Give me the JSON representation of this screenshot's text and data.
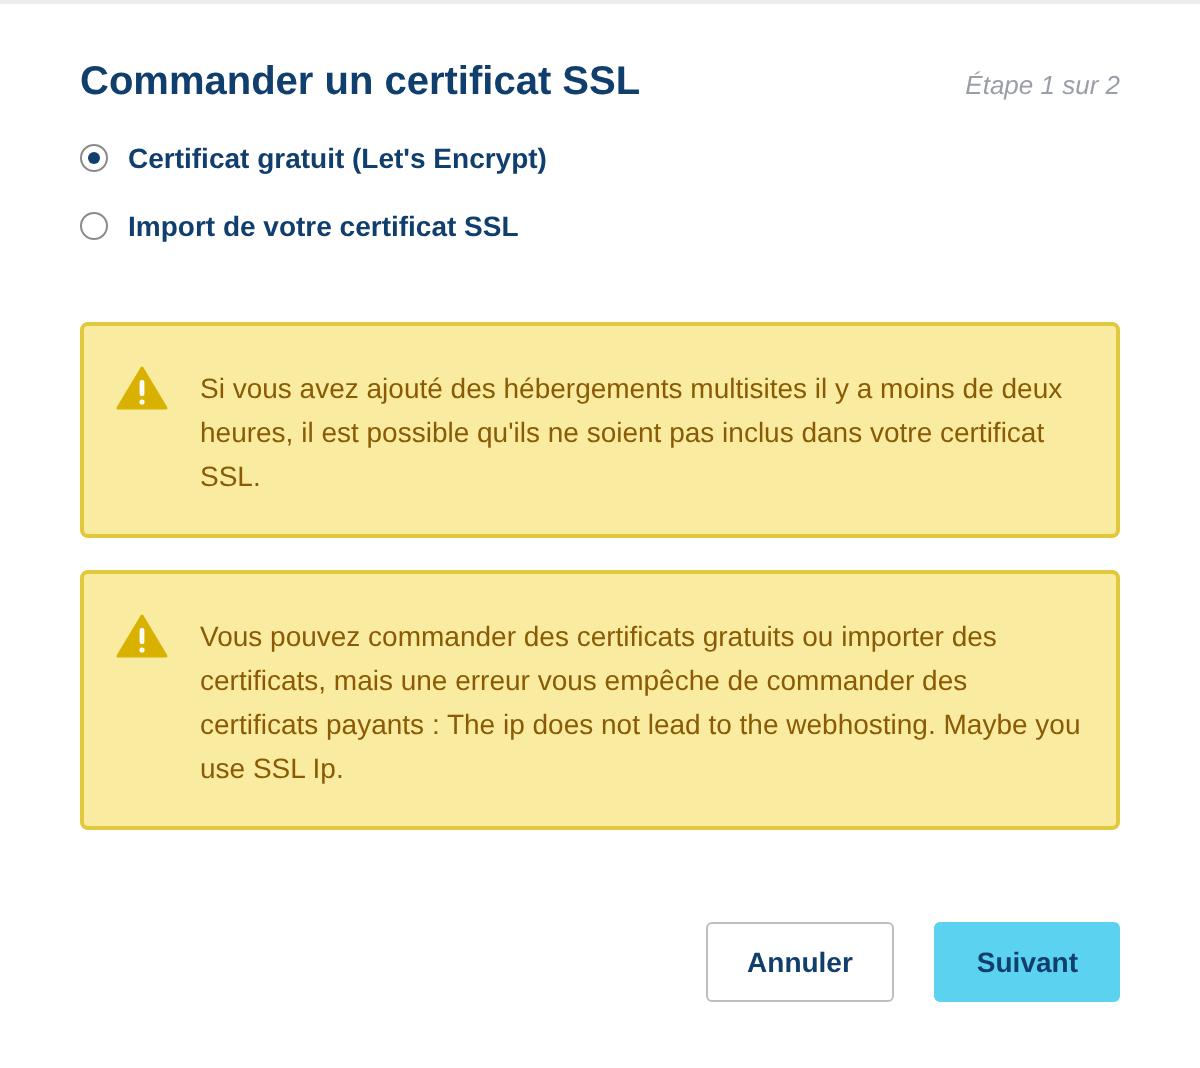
{
  "dialog": {
    "title": "Commander un certificat SSL",
    "step": "Étape 1 sur 2"
  },
  "options": [
    {
      "label": "Certificat gratuit (Let's Encrypt)",
      "selected": true
    },
    {
      "label": "Import de votre certificat SSL",
      "selected": false
    }
  ],
  "alerts": [
    {
      "kind": "warning",
      "text": "Si vous avez ajouté des hébergements multisites il y a moins de deux heures, il est possible qu'ils ne soient pas inclus dans votre certificat SSL."
    },
    {
      "kind": "warning",
      "text": "Vous pouvez commander des certificats gratuits ou importer des certificats, mais une erreur vous empêche de commander des certificats payants : The ip does not lead to the webhosting. Maybe you use SSL Ip."
    }
  ],
  "buttons": [
    {
      "label": "Annuler",
      "kind": "secondary"
    },
    {
      "label": "Suivant",
      "kind": "primary"
    }
  ]
}
